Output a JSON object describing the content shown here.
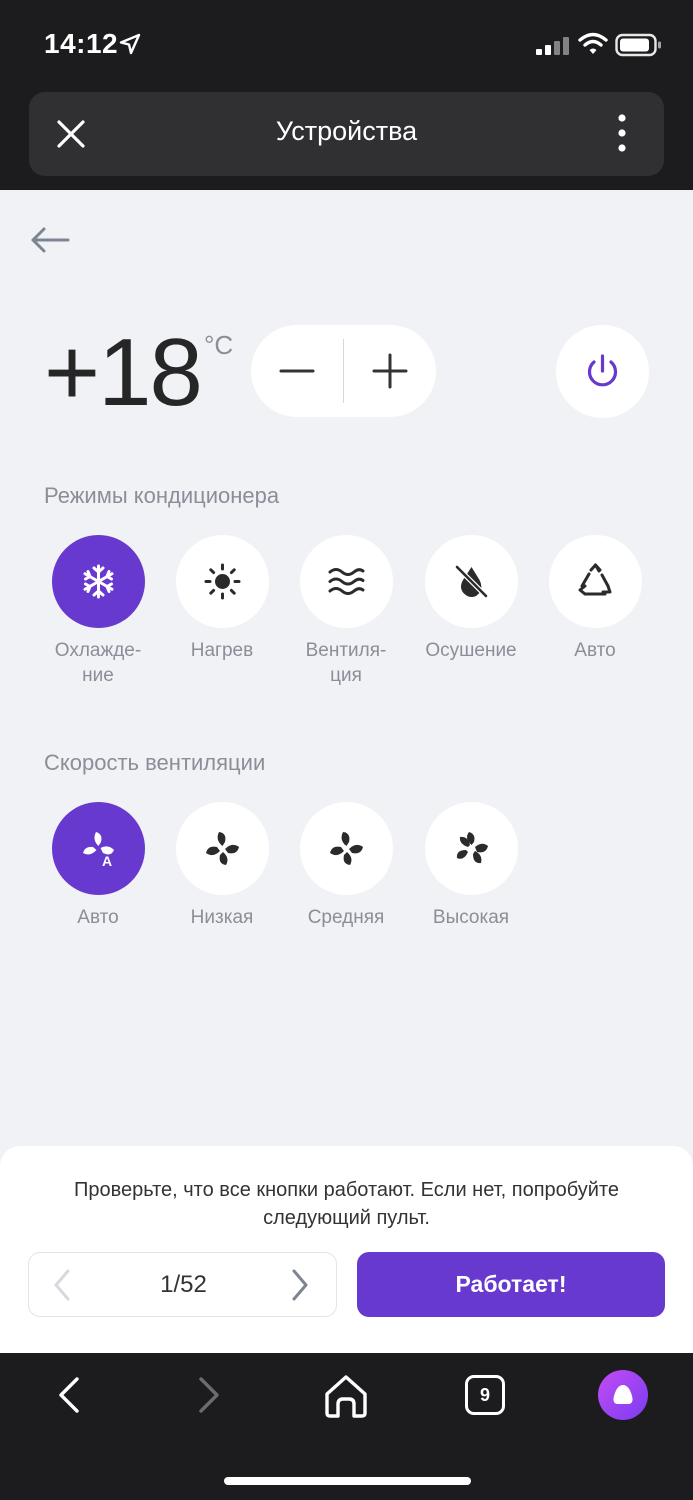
{
  "status_bar": {
    "time": "14:12"
  },
  "header": {
    "title": "Устройства"
  },
  "climate": {
    "temperature": "+18",
    "unit": "°C",
    "accent_color": "#6839cf"
  },
  "modes": {
    "title": "Режимы кондиционера",
    "items": [
      {
        "label": "Охлажде-\nние",
        "icon": "snowflake-icon",
        "active": true
      },
      {
        "label": "Нагрев",
        "icon": "sun-icon",
        "active": false
      },
      {
        "label": "Вентиля-\nция",
        "icon": "waves-icon",
        "active": false
      },
      {
        "label": "Осушение",
        "icon": "drop-off-icon",
        "active": false
      },
      {
        "label": "Авто",
        "icon": "recycle-icon",
        "active": false
      }
    ]
  },
  "fan_speed": {
    "title": "Скорость вентиляции",
    "items": [
      {
        "label": "Авто",
        "icon": "fan-auto-icon",
        "active": true
      },
      {
        "label": "Низкая",
        "icon": "fan-icon",
        "active": false
      },
      {
        "label": "Средняя",
        "icon": "fan-icon",
        "active": false
      },
      {
        "label": "Высокая",
        "icon": "fan-icon",
        "active": false
      }
    ]
  },
  "check_panel": {
    "hint": "Проверьте, что все кнопки работают. Если нет, попробуйте следующий пульт.",
    "pager": "1/52",
    "works_button": "Работает!"
  },
  "browser_nav": {
    "tabs_count": "9"
  }
}
